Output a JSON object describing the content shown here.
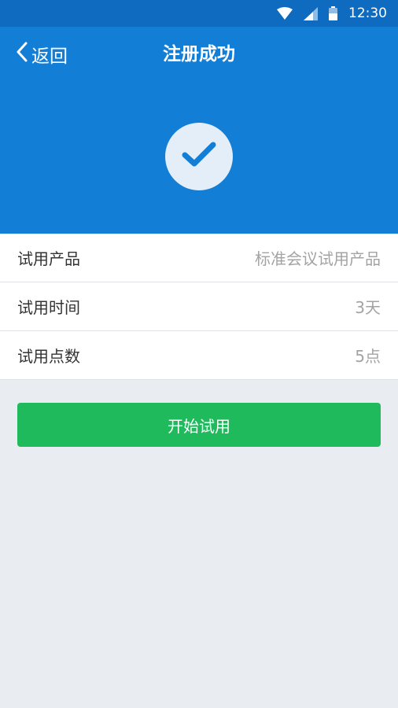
{
  "status_bar": {
    "time": "12:30",
    "icons": [
      "wifi-icon",
      "cell-signal-icon",
      "battery-icon"
    ]
  },
  "nav": {
    "back_label": "返回",
    "title": "注册成功"
  },
  "success": {
    "icon": "checkmark-icon"
  },
  "info": {
    "rows": [
      {
        "label": "试用产品",
        "value": "标准会议试用产品"
      },
      {
        "label": "试用时间",
        "value": "3天"
      },
      {
        "label": "试用点数",
        "value": "5点"
      }
    ]
  },
  "actions": {
    "start_label": "开始试用"
  },
  "colors": {
    "status_bar": "#0f6bbf",
    "header": "#137ed6",
    "button": "#1fba5b",
    "background": "#e9ecf1"
  }
}
